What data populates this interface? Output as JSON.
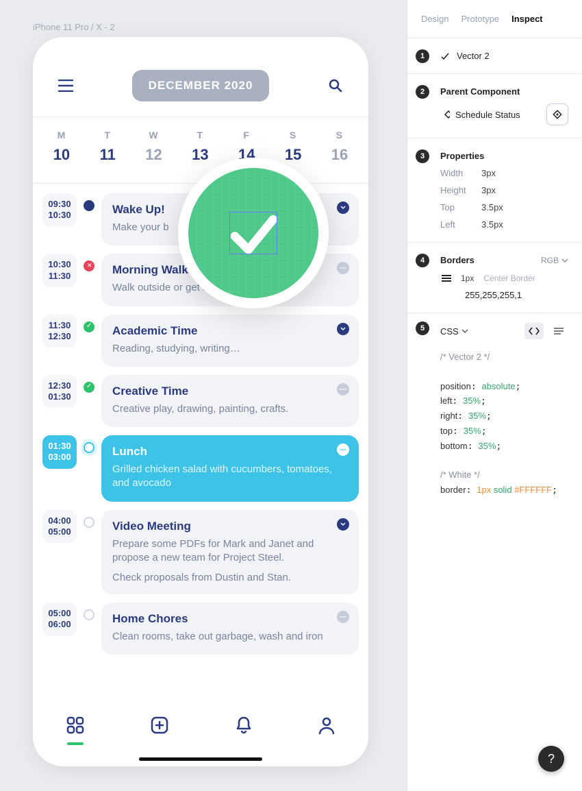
{
  "frame_label": "iPhone 11 Pro / X - 2",
  "month": "DECEMBER 2020",
  "weekdays": [
    {
      "dow": "M",
      "num": "10",
      "faded": false
    },
    {
      "dow": "T",
      "num": "11",
      "faded": false
    },
    {
      "dow": "W",
      "num": "12",
      "faded": true
    },
    {
      "dow": "T",
      "num": "13",
      "faded": false
    },
    {
      "dow": "F",
      "num": "14",
      "faded": false
    },
    {
      "dow": "S",
      "num": "15",
      "faded": false
    },
    {
      "dow": "S",
      "num": "16",
      "faded": true
    }
  ],
  "tasks": [
    {
      "t1": "09:30",
      "t2": "10:30",
      "title": "Wake Up!",
      "desc": "Make your b",
      "status": "blue",
      "expand": "open",
      "active": false
    },
    {
      "t1": "10:30",
      "t2": "11:30",
      "title": "Morning Walk",
      "desc": "Walk outside or get some exercise.",
      "status": "red",
      "expand": "closed",
      "active": false
    },
    {
      "t1": "11:30",
      "t2": "12:30",
      "title": "Academic Time",
      "desc": "Reading, studying, writing…",
      "status": "green",
      "expand": "open",
      "active": false
    },
    {
      "t1": "12:30",
      "t2": "01:30",
      "title": "Creative Time",
      "desc": "Creative play, drawing, painting, crafts.",
      "status": "green",
      "expand": "closed",
      "active": false
    },
    {
      "t1": "01:30",
      "t2": "03:00",
      "title": "Lunch",
      "desc": "Grilled chicken salad with cucumbers, tomatoes, and avocado",
      "status": "pulse",
      "expand": "active",
      "active": true
    },
    {
      "t1": "04:00",
      "t2": "05:00",
      "title": "Video Meeting",
      "desc": "Prepare some PDFs for Mark and Janet and propose a new team for Project Steel.",
      "extra": "Check proposals from Dustin and Stan.",
      "status": "empty",
      "expand": "open",
      "active": false
    },
    {
      "t1": "05:00",
      "t2": "06:00",
      "title": "Home Chores",
      "desc": "Clean rooms, take out garbage, wash and iron",
      "status": "empty",
      "expand": "closed",
      "active": false
    }
  ],
  "panel": {
    "tabs": [
      "Design",
      "Prototype",
      "Inspect"
    ],
    "active_tab": 2,
    "layer": "Vector 2",
    "parent_title": "Parent Component",
    "parent_name": "Schedule Status",
    "props_title": "Properties",
    "props": [
      {
        "k": "Width",
        "v": "3px"
      },
      {
        "k": "Height",
        "v": "3px"
      },
      {
        "k": "Top",
        "v": "3.5px"
      },
      {
        "k": "Left",
        "v": "3.5px"
      }
    ],
    "borders_title": "Borders",
    "color_mode": "RGB",
    "border_width": "1px",
    "border_type": "Center Border",
    "border_color": "255,255,255,1",
    "lang": "CSS",
    "code_lines": [
      {
        "type": "comment",
        "text": "/* Vector 2 */"
      },
      {
        "type": "blank"
      },
      {
        "type": "prop",
        "k": "position",
        "v": "absolute"
      },
      {
        "type": "prop",
        "k": "left",
        "v": "35%"
      },
      {
        "type": "prop",
        "k": "right",
        "v": "35%"
      },
      {
        "type": "prop",
        "k": "top",
        "v": "35%"
      },
      {
        "type": "prop",
        "k": "bottom",
        "v": "35%"
      },
      {
        "type": "blank"
      },
      {
        "type": "comment",
        "text": "/* White */"
      },
      {
        "type": "prop",
        "k": "border",
        "v": "1px solid #FFFFFF"
      }
    ]
  },
  "badges": {
    "layer": "1",
    "parent": "2",
    "props": "3",
    "borders": "4",
    "code": "5"
  }
}
